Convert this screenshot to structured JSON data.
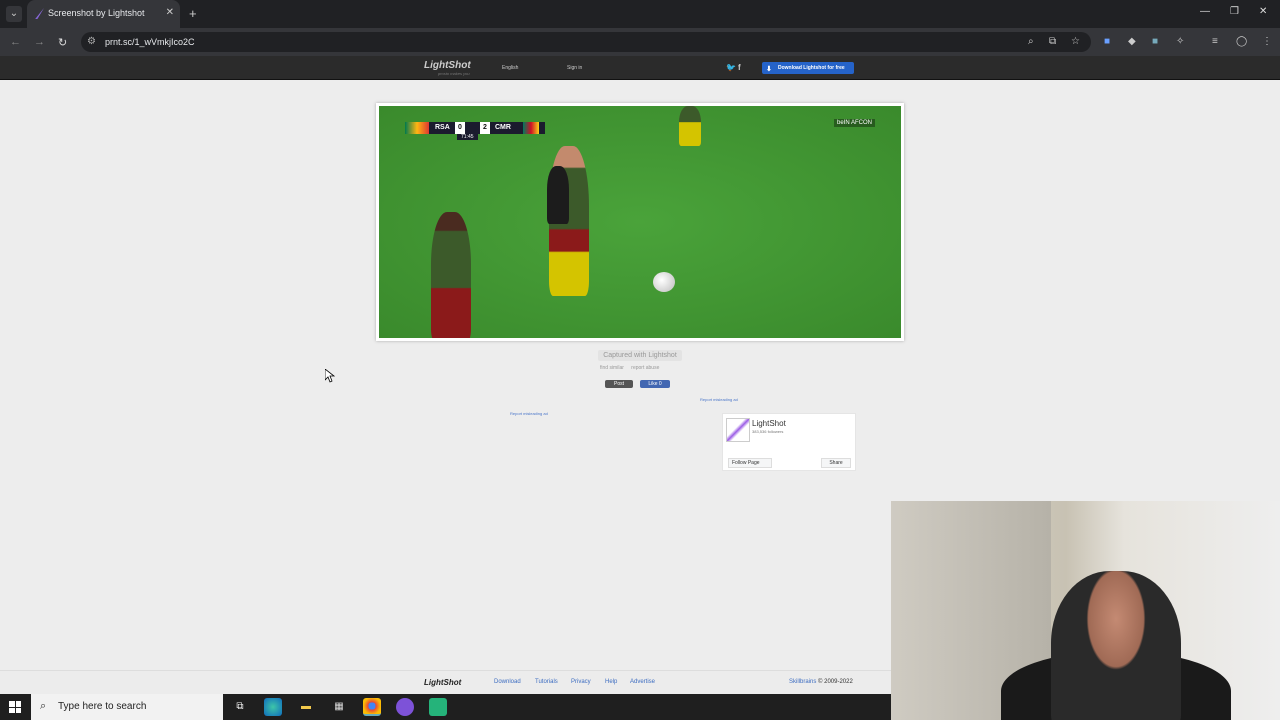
{
  "browser": {
    "tab_title": "Screenshot by Lightshot",
    "url": "prnt.sc/1_wVmkjIco2C",
    "new_tab": "+",
    "tab_close": "✕"
  },
  "lightshot_header": {
    "logo": "LightShot",
    "tagline": "prosto makes you",
    "language": "English",
    "sign_in": "Sign in",
    "download_button": "Download Lightshot for free"
  },
  "screenshot": {
    "scorebug": {
      "team1": "RSA",
      "score1": "0",
      "score2": "2",
      "team2": "CMR",
      "clock": "71:45"
    },
    "channel": "beIN AFCON"
  },
  "below_image": {
    "caption": "Captured with Lightshot",
    "find_similar": "find similar",
    "report_abuse": "report abuse",
    "post_button": "Post",
    "like_button": "Like 0",
    "report_ad_1": "Report misleading ad",
    "report_ad_2": "Report misleading ad"
  },
  "fb_widget": {
    "name": "LightShot",
    "followers": "383,536 followers",
    "follow_button": "Follow Page",
    "share_button": "Share"
  },
  "footer": {
    "logo": "LightShot",
    "links": [
      "Download",
      "Tutorials",
      "Privacy",
      "Help",
      "Advertise"
    ],
    "company": "Skillbrains",
    "copyright": "© 2009-2022"
  },
  "taskbar": {
    "search_placeholder": "Type here to search"
  },
  "colors": {
    "accent_blue": "#2563c9",
    "link_blue": "#3d6dc1",
    "field_green": "#4aa33a"
  }
}
